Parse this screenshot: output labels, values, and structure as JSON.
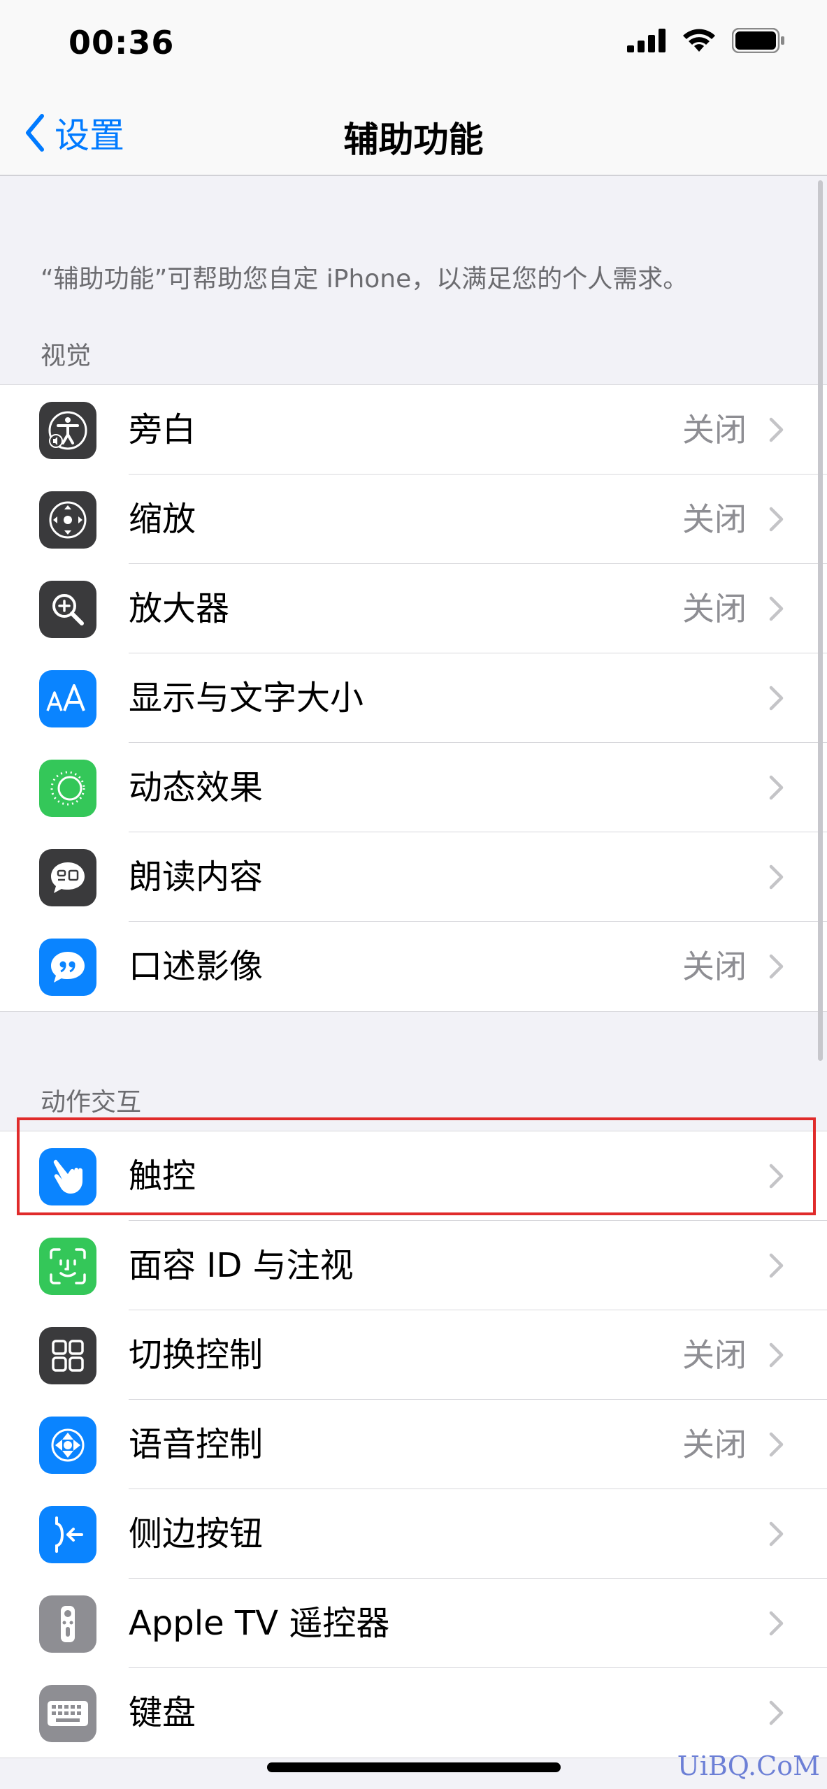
{
  "status_bar": {
    "time": "00:36"
  },
  "nav": {
    "back_label": "设置",
    "title": "辅助功能"
  },
  "intro": "“辅助功能”可帮助您自定 iPhone，以满足您的个人需求。",
  "sections": [
    {
      "title": "视觉",
      "items": [
        {
          "label": "旁白",
          "value": "关闭",
          "icon": "voiceover-icon",
          "color": "#3a3a3c"
        },
        {
          "label": "缩放",
          "value": "关闭",
          "icon": "zoom-icon",
          "color": "#3a3a3c"
        },
        {
          "label": "放大器",
          "value": "关闭",
          "icon": "magnifier-icon",
          "color": "#3a3a3c"
        },
        {
          "label": "显示与文字大小",
          "value": "",
          "icon": "text-size-icon",
          "color": "#0a84ff"
        },
        {
          "label": "动态效果",
          "value": "",
          "icon": "motion-icon",
          "color": "#34c759"
        },
        {
          "label": "朗读内容",
          "value": "",
          "icon": "spoken-content-icon",
          "color": "#3a3a3c"
        },
        {
          "label": "口述影像",
          "value": "关闭",
          "icon": "audio-description-icon",
          "color": "#0a84ff"
        }
      ]
    },
    {
      "title": "动作交互",
      "items": [
        {
          "label": "触控",
          "value": "",
          "icon": "touch-icon",
          "color": "#0a84ff"
        },
        {
          "label": "面容 ID 与注视",
          "value": "",
          "icon": "face-id-icon",
          "color": "#34c759"
        },
        {
          "label": "切换控制",
          "value": "关闭",
          "icon": "switch-control-icon",
          "color": "#3a3a3c"
        },
        {
          "label": "语音控制",
          "value": "关闭",
          "icon": "voice-control-icon",
          "color": "#0a84ff"
        },
        {
          "label": "侧边按钮",
          "value": "",
          "icon": "side-button-icon",
          "color": "#0a84ff"
        },
        {
          "label": "Apple TV 遥控器",
          "value": "",
          "icon": "apple-tv-remote-icon",
          "color": "#8e8e93"
        },
        {
          "label": "键盘",
          "value": "",
          "icon": "keyboard-icon",
          "color": "#8e8e93"
        }
      ]
    }
  ],
  "watermark": "UiBQ.CoM"
}
